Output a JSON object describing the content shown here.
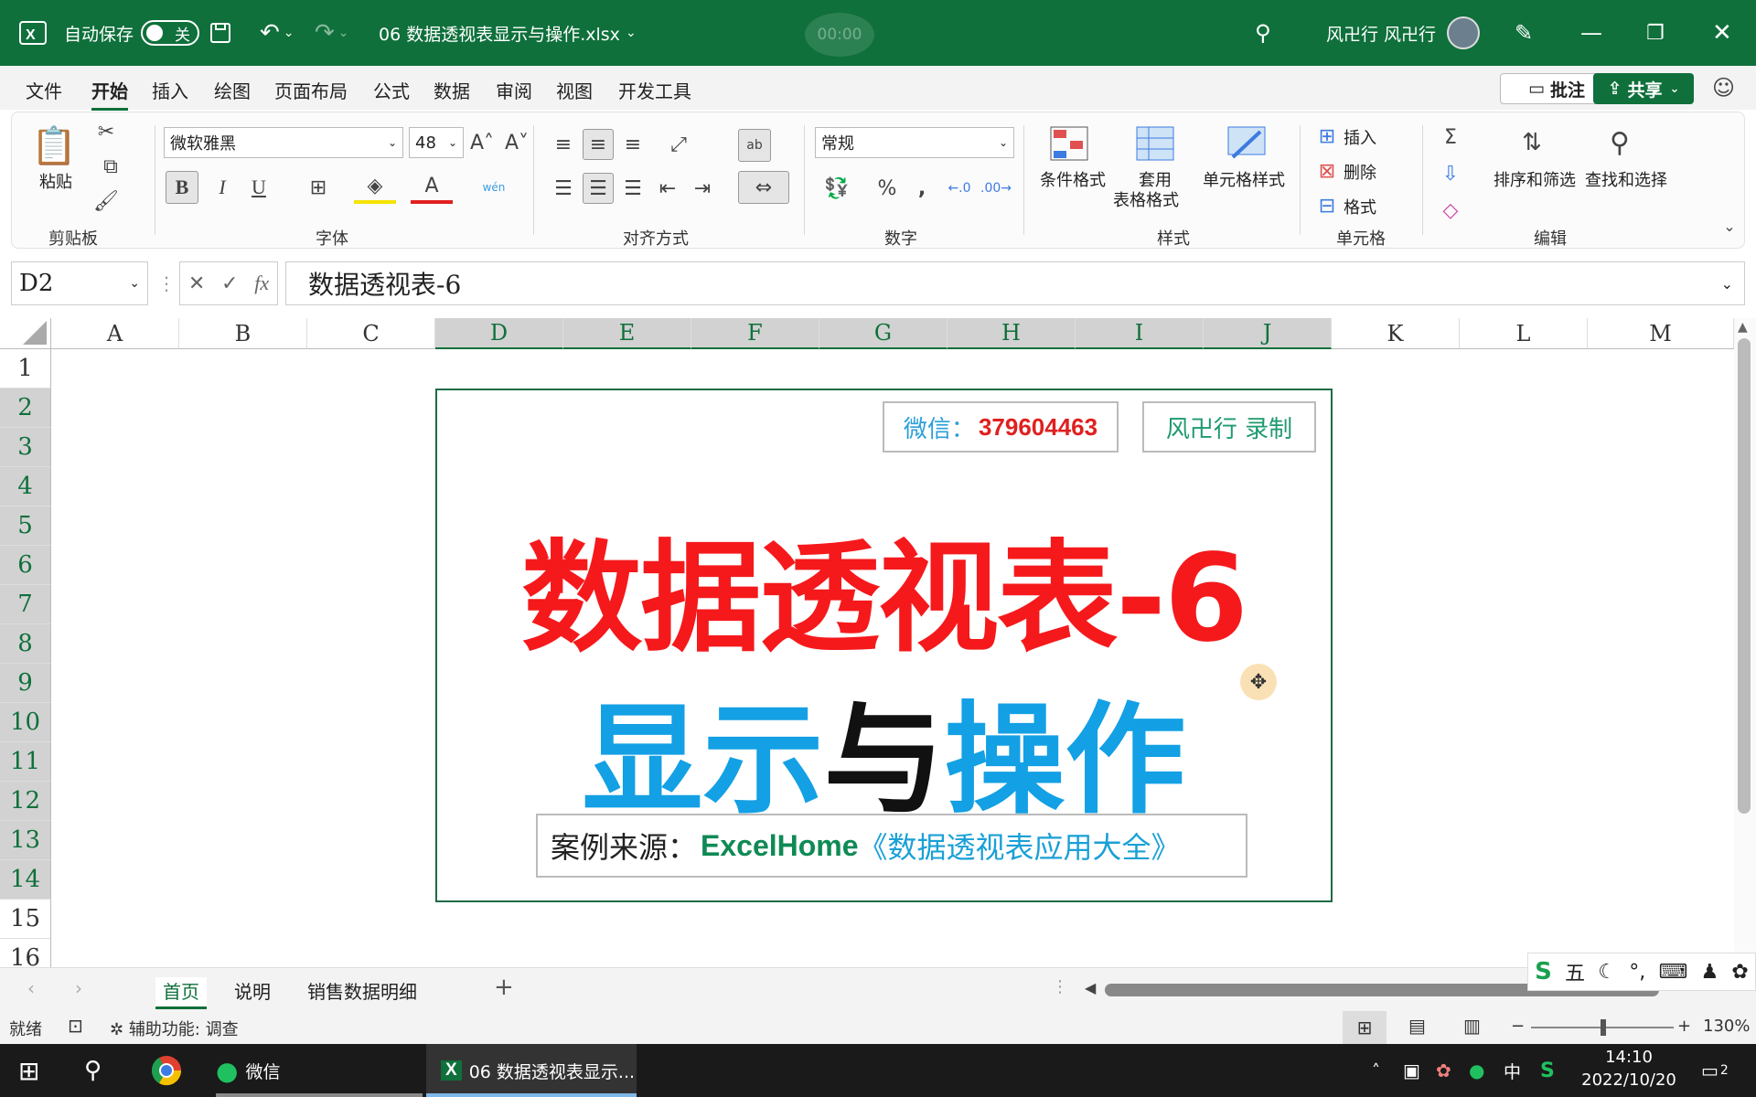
{
  "titlebar": {
    "autosave_label": "自动保存",
    "autosave_state": "关",
    "filename": "06 数据透视表显示与操作.xlsx",
    "timer": "00:00",
    "user": "风卍行 风卍行"
  },
  "ribbon_tabs": [
    "文件",
    "开始",
    "插入",
    "绘图",
    "页面布局",
    "公式",
    "数据",
    "审阅",
    "视图",
    "开发工具"
  ],
  "buttons": {
    "comment": "批注",
    "share": "共享"
  },
  "ribbon": {
    "clipboard": {
      "paste": "粘贴",
      "label": "剪贴板"
    },
    "font": {
      "name": "微软雅黑",
      "size": "48",
      "label": "字体",
      "bold": "B",
      "italic": "I",
      "underline": "U",
      "phonetic": "wén"
    },
    "align": {
      "label": "对齐方式"
    },
    "number": {
      "format": "常规",
      "label": "数字"
    },
    "styles": {
      "cond": "条件格式",
      "table1": "套用",
      "table2": "表格格式",
      "cell": "单元格样式",
      "label": "样式"
    },
    "cells": {
      "insert": "插入",
      "delete": "删除",
      "format": "格式",
      "label": "单元格"
    },
    "edit": {
      "sort": "排序和筛选",
      "find": "查找和选择",
      "label": "编辑"
    }
  },
  "formula_bar": {
    "cell_ref": "D2",
    "fx": "fx",
    "content": "数据透视表-6"
  },
  "columns": [
    "A",
    "B",
    "C",
    "D",
    "E",
    "F",
    "G",
    "H",
    "I",
    "J",
    "K",
    "L",
    "M"
  ],
  "rows": [
    "1",
    "2",
    "3",
    "4",
    "5",
    "6",
    "7",
    "8",
    "9",
    "10",
    "11",
    "12",
    "13",
    "14",
    "15",
    "16"
  ],
  "card": {
    "wechat_label": "微信：",
    "wechat_id": "379604463",
    "recorder": "风卍行 录制",
    "title_line1": "数据透视表-6",
    "title_line2_a": "显示",
    "title_line2_b": "与",
    "title_line2_c": "操作",
    "source_label": "案例来源：",
    "source_org": "ExcelHome",
    "source_book": "《数据透视表应用大全》"
  },
  "sheets": [
    "首页",
    "说明",
    "销售数据明细"
  ],
  "status": {
    "ready": "就绪",
    "accessibility": "辅助功能: 调查",
    "zoom": "130%"
  },
  "ime": {
    "mode": "五"
  },
  "taskbar": {
    "wechat": "微信",
    "excel": "06 数据透视表显示...",
    "lang": "中",
    "time": "14:10",
    "date": "2022/10/20",
    "notif": "2"
  },
  "colors": {
    "excel_green": "#0f703b",
    "title_red": "#f5191c",
    "title_blue": "#13a0e4"
  }
}
